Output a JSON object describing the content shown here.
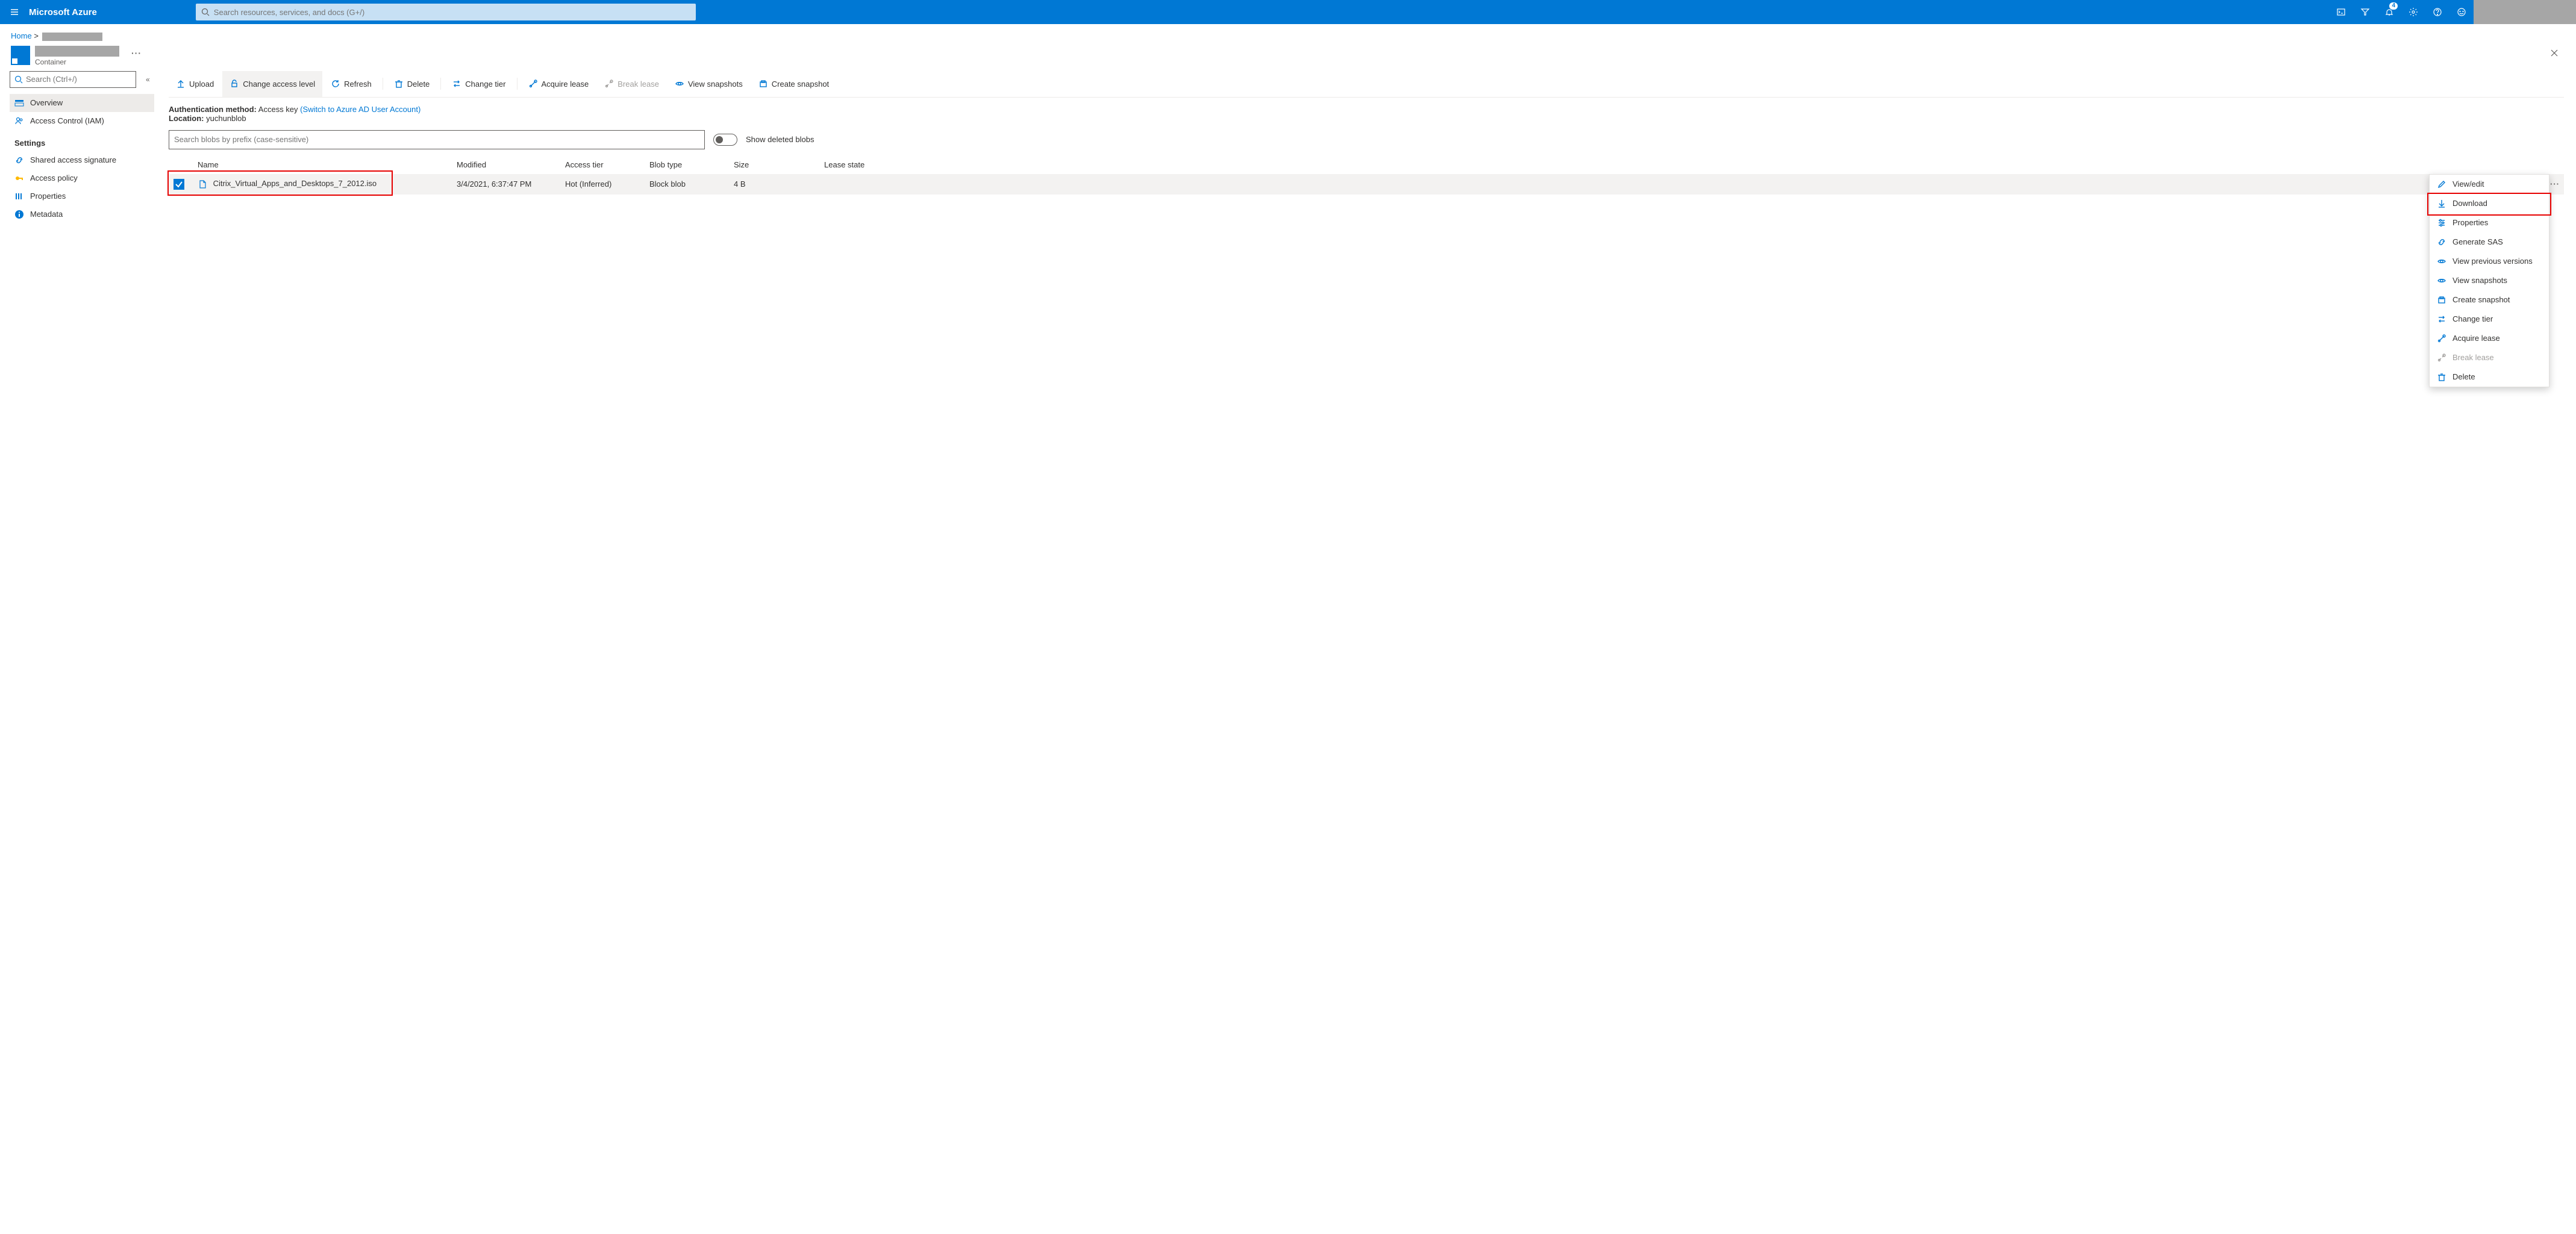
{
  "topbar": {
    "brand": "Microsoft Azure",
    "search_placeholder": "Search resources, services, and docs (G+/)",
    "notification_badge": "4"
  },
  "breadcrumb": {
    "home": "Home"
  },
  "header": {
    "subtitle": "Container"
  },
  "sidebar": {
    "search_placeholder": "Search (Ctrl+/)",
    "items": [
      {
        "label": "Overview"
      },
      {
        "label": "Access Control (IAM)"
      }
    ],
    "settings_heading": "Settings",
    "settings_items": [
      {
        "label": "Shared access signature"
      },
      {
        "label": "Access policy"
      },
      {
        "label": "Properties"
      },
      {
        "label": "Metadata"
      }
    ]
  },
  "cmdbar": {
    "upload": "Upload",
    "change_access": "Change access level",
    "refresh": "Refresh",
    "delete": "Delete",
    "change_tier": "Change tier",
    "acquire_lease": "Acquire lease",
    "break_lease": "Break lease",
    "view_snapshots": "View snapshots",
    "create_snapshot": "Create snapshot"
  },
  "info": {
    "auth_label": "Authentication method:",
    "auth_value": "Access key",
    "auth_link": "(Switch to Azure AD User Account)",
    "loc_label": "Location:",
    "loc_value": "yuchunblob"
  },
  "filter": {
    "placeholder": "Search blobs by prefix (case-sensitive)",
    "toggle_label": "Show deleted blobs"
  },
  "table": {
    "headers": {
      "name": "Name",
      "modified": "Modified",
      "tier": "Access tier",
      "type": "Blob type",
      "size": "Size",
      "lease": "Lease state"
    },
    "rows": [
      {
        "name": "Citrix_Virtual_Apps_and_Desktops_7_2012.iso",
        "modified": "3/4/2021, 6:37:47 PM",
        "tier": "Hot (Inferred)",
        "type": "Block blob",
        "size": "4 B",
        "lease": ""
      }
    ]
  },
  "ctx": {
    "view_edit": "View/edit",
    "download": "Download",
    "properties": "Properties",
    "generate_sas": "Generate SAS",
    "view_prev": "View previous versions",
    "view_snap": "View snapshots",
    "create_snap": "Create snapshot",
    "change_tier": "Change tier",
    "acquire_lease": "Acquire lease",
    "break_lease": "Break lease",
    "delete": "Delete"
  }
}
